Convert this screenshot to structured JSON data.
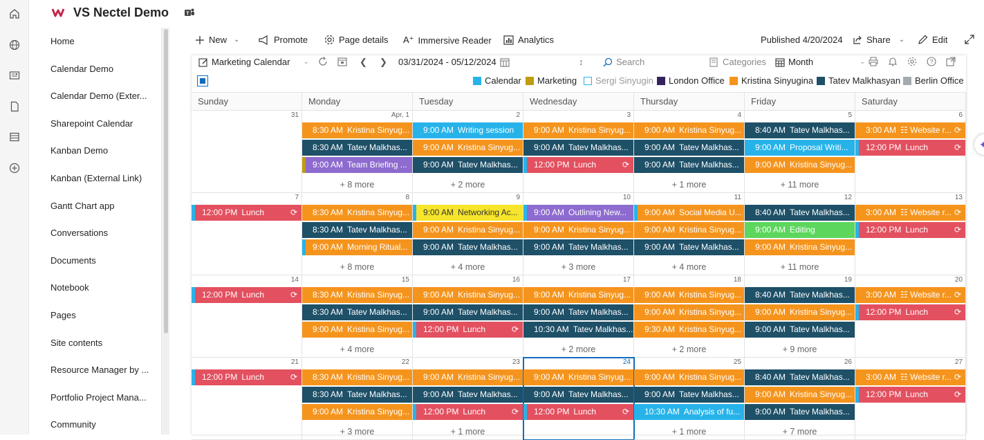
{
  "site": {
    "title": "VS Nectel Demo"
  },
  "rail": [
    "home-icon",
    "globe-icon",
    "news-icon",
    "file-icon",
    "list-icon",
    "add-icon"
  ],
  "nav": [
    "Home",
    "Calendar Demo",
    "Calendar Demo (Exter...",
    "Sharepoint Calendar",
    "Kanban Demo",
    "Kanban (External Link)",
    "Gantt Chart app",
    "Conversations",
    "Documents",
    "Notebook",
    "Pages",
    "Site contents",
    "Resource Manager by ...",
    "Portfolio Project Mana...",
    "Community"
  ],
  "command": {
    "new": "New",
    "promote": "Promote",
    "page_details": "Page details",
    "immersive": "Immersive Reader",
    "analytics": "Analytics",
    "published": "Published 4/20/2024",
    "share": "Share",
    "edit": "Edit"
  },
  "calendar": {
    "name": "Marketing Calendar",
    "range": "03/31/2024 - 05/12/2024",
    "search_placeholder": "Search",
    "categories": "Categories",
    "view": "Month",
    "legend": [
      {
        "label": "Calendar",
        "color": "#27b3ea",
        "outline": false
      },
      {
        "label": "Marketing",
        "color": "#c09b10",
        "outline": false
      },
      {
        "label": "Sergi Sinyugin",
        "color": "#ffffff",
        "outline": true
      },
      {
        "label": "London Office",
        "color": "#34225c",
        "outline": false
      },
      {
        "label": "Kristina Sinyugina",
        "color": "#f5941d",
        "outline": false
      },
      {
        "label": "Tatev Malkhasyan",
        "color": "#1e5068",
        "outline": false
      },
      {
        "label": "Berlin Office",
        "color": "#a5aaae",
        "outline": false
      }
    ],
    "days": [
      "Sunday",
      "Monday",
      "Tuesday",
      "Wednesday",
      "Thursday",
      "Friday",
      "Saturday"
    ],
    "weeks": [
      {
        "nums": [
          "31",
          "Apr, 1",
          "2",
          "3",
          "4",
          "5",
          "6"
        ],
        "events": [
          [],
          [
            {
              "t": "8:30 AM",
              "n": "Kristina Sinyug...",
              "c": "orange"
            },
            {
              "t": "8:30 AM",
              "n": "Tatev Malkhas...",
              "c": "teal"
            },
            {
              "t": "9:00 AM",
              "n": "Team Briefing ...",
              "c": "purple",
              "b": "#c09b10"
            }
          ],
          [
            {
              "t": "9:00 AM",
              "n": "Writing session",
              "c": "blue"
            },
            {
              "t": "9:00 AM",
              "n": "Kristina Sinyug...",
              "c": "orange"
            },
            {
              "t": "9:00 AM",
              "n": "Tatev Malkhas...",
              "c": "teal"
            }
          ],
          [
            {
              "t": "9:00 AM",
              "n": "Kristina Sinyug...",
              "c": "orange"
            },
            {
              "t": "9:00 AM",
              "n": "Tatev Malkhas...",
              "c": "teal"
            },
            {
              "t": "12:00 PM",
              "n": "Lunch",
              "c": "red",
              "b": "#27b3ea",
              "r": true
            }
          ],
          [
            {
              "t": "9:00 AM",
              "n": "Kristina Sinyug...",
              "c": "orange"
            },
            {
              "t": "9:00 AM",
              "n": "Tatev Malkhas...",
              "c": "teal"
            },
            {
              "t": "9:00 AM",
              "n": "Tatev Malkhas...",
              "c": "teal"
            }
          ],
          [
            {
              "t": "8:40 AM",
              "n": "Tatev Malkhas...",
              "c": "teal"
            },
            {
              "t": "9:00 AM",
              "n": "Proposal Writi...",
              "c": "blue"
            },
            {
              "t": "9:00 AM",
              "n": "Kristina Sinyug...",
              "c": "orange"
            }
          ],
          [
            {
              "t": "3:00 AM",
              "n": "Website r...",
              "c": "orange",
              "r": true,
              "teams": true
            },
            {
              "t": "12:00 PM",
              "n": "Lunch",
              "c": "red",
              "b": "#27b3ea",
              "r": true
            }
          ]
        ],
        "more": [
          "",
          "+ 8 more",
          "+ 2 more",
          "",
          "+ 1 more",
          "+ 11 more",
          ""
        ]
      },
      {
        "nums": [
          "7",
          "8",
          "9",
          "10",
          "11",
          "12",
          "13"
        ],
        "events": [
          [
            {
              "t": "12:00 PM",
              "n": "Lunch",
              "c": "red",
              "b": "#27b3ea",
              "r": true
            }
          ],
          [
            {
              "t": "8:30 AM",
              "n": "Kristina Sinyug...",
              "c": "orange"
            },
            {
              "t": "8:30 AM",
              "n": "Tatev Malkhas...",
              "c": "teal"
            },
            {
              "t": "9:00 AM",
              "n": "Morning Ritual...",
              "c": "orange",
              "b": "#27b3ea"
            }
          ],
          [
            {
              "t": "9:00 AM",
              "n": "Networking Ac...",
              "c": "yellow",
              "b": "#27b3ea"
            },
            {
              "t": "9:00 AM",
              "n": "Kristina Sinyug...",
              "c": "orange"
            },
            {
              "t": "9:00 AM",
              "n": "Tatev Malkhas...",
              "c": "teal"
            }
          ],
          [
            {
              "t": "9:00 AM",
              "n": "Outlining New...",
              "c": "purple",
              "b": "#27b3ea"
            },
            {
              "t": "9:00 AM",
              "n": "Kristina Sinyug...",
              "c": "orange"
            },
            {
              "t": "9:00 AM",
              "n": "Tatev Malkhas...",
              "c": "teal"
            }
          ],
          [
            {
              "t": "9:00 AM",
              "n": "Social Media U...",
              "c": "orange",
              "b": "#27b3ea"
            },
            {
              "t": "9:00 AM",
              "n": "Kristina Sinyug...",
              "c": "orange"
            },
            {
              "t": "9:00 AM",
              "n": "Tatev Malkhas...",
              "c": "teal"
            }
          ],
          [
            {
              "t": "8:40 AM",
              "n": "Tatev Malkhas...",
              "c": "teal"
            },
            {
              "t": "9:00 AM",
              "n": "Editing",
              "c": "green"
            },
            {
              "t": "9:00 AM",
              "n": "Kristina Sinyug...",
              "c": "orange"
            }
          ],
          [
            {
              "t": "3:00 AM",
              "n": "Website r...",
              "c": "orange",
              "r": true,
              "teams": true
            },
            {
              "t": "12:00 PM",
              "n": "Lunch",
              "c": "red",
              "b": "#27b3ea",
              "r": true
            }
          ]
        ],
        "more": [
          "",
          "+ 8 more",
          "+ 4 more",
          "+ 3 more",
          "+ 4 more",
          "+ 11 more",
          ""
        ]
      },
      {
        "nums": [
          "14",
          "15",
          "16",
          "17",
          "18",
          "19",
          "20"
        ],
        "events": [
          [
            {
              "t": "12:00 PM",
              "n": "Lunch",
              "c": "red",
              "b": "#27b3ea",
              "r": true
            }
          ],
          [
            {
              "t": "8:30 AM",
              "n": "Kristina Sinyug...",
              "c": "orange"
            },
            {
              "t": "8:30 AM",
              "n": "Tatev Malkhas...",
              "c": "teal"
            },
            {
              "t": "9:00 AM",
              "n": "Kristina Sinyug...",
              "c": "orange"
            }
          ],
          [
            {
              "t": "9:00 AM",
              "n": "Kristina Sinyug...",
              "c": "orange"
            },
            {
              "t": "9:00 AM",
              "n": "Tatev Malkhas...",
              "c": "teal"
            },
            {
              "t": "12:00 PM",
              "n": "Lunch",
              "c": "red",
              "b": "#27b3ea",
              "r": true
            }
          ],
          [
            {
              "t": "9:00 AM",
              "n": "Kristina Sinyug...",
              "c": "orange"
            },
            {
              "t": "9:00 AM",
              "n": "Tatev Malkhas...",
              "c": "teal"
            },
            {
              "t": "10:30 AM",
              "n": "Tatev Malkhas...",
              "c": "teal"
            }
          ],
          [
            {
              "t": "9:00 AM",
              "n": "Kristina Sinyug...",
              "c": "orange"
            },
            {
              "t": "9:00 AM",
              "n": "Kristina Sinyug...",
              "c": "orange"
            },
            {
              "t": "9:30 AM",
              "n": "Kristina Sinyug...",
              "c": "orange"
            }
          ],
          [
            {
              "t": "8:40 AM",
              "n": "Tatev Malkhas...",
              "c": "teal"
            },
            {
              "t": "9:00 AM",
              "n": "Kristina Sinyug...",
              "c": "orange"
            },
            {
              "t": "9:00 AM",
              "n": "Tatev Malkhas...",
              "c": "teal"
            }
          ],
          [
            {
              "t": "3:00 AM",
              "n": "Website r...",
              "c": "orange",
              "r": true,
              "teams": true
            },
            {
              "t": "12:00 PM",
              "n": "Lunch",
              "c": "red",
              "b": "#27b3ea",
              "r": true
            }
          ]
        ],
        "more": [
          "",
          "+ 4 more",
          "",
          "+ 2 more",
          "+ 2 more",
          "+ 9 more",
          ""
        ]
      },
      {
        "nums": [
          "21",
          "22",
          "23",
          "24",
          "25",
          "26",
          "27"
        ],
        "events": [
          [
            {
              "t": "12:00 PM",
              "n": "Lunch",
              "c": "red",
              "b": "#27b3ea",
              "r": true
            }
          ],
          [
            {
              "t": "8:30 AM",
              "n": "Kristina Sinyug...",
              "c": "orange"
            },
            {
              "t": "8:30 AM",
              "n": "Tatev Malkhas...",
              "c": "teal"
            },
            {
              "t": "9:00 AM",
              "n": "Kristina Sinyug...",
              "c": "orange"
            }
          ],
          [
            {
              "t": "9:00 AM",
              "n": "Kristina Sinyug...",
              "c": "orange"
            },
            {
              "t": "9:00 AM",
              "n": "Tatev Malkhas...",
              "c": "teal"
            },
            {
              "t": "12:00 PM",
              "n": "Lunch",
              "c": "red",
              "b": "#27b3ea",
              "r": true
            }
          ],
          [
            {
              "t": "9:00 AM",
              "n": "Kristina Sinyug...",
              "c": "orange"
            },
            {
              "t": "9:00 AM",
              "n": "Tatev Malkhas...",
              "c": "teal"
            },
            {
              "t": "12:00 PM",
              "n": "Lunch",
              "c": "red",
              "b": "#27b3ea",
              "r": true
            }
          ],
          [
            {
              "t": "9:00 AM",
              "n": "Kristina Sinyug...",
              "c": "orange"
            },
            {
              "t": "9:00 AM",
              "n": "Tatev Malkhas...",
              "c": "teal"
            },
            {
              "t": "10:30 AM",
              "n": "Analysis of fu...",
              "c": "blue"
            }
          ],
          [
            {
              "t": "8:40 AM",
              "n": "Tatev Malkhas...",
              "c": "teal"
            },
            {
              "t": "9:00 AM",
              "n": "Kristina Sinyug...",
              "c": "orange"
            },
            {
              "t": "9:00 AM",
              "n": "Tatev Malkhas...",
              "c": "teal"
            }
          ],
          [
            {
              "t": "3:00 AM",
              "n": "Website r...",
              "c": "orange",
              "r": true,
              "teams": true
            },
            {
              "t": "12:00 PM",
              "n": "Lunch",
              "c": "red",
              "b": "#27b3ea",
              "r": true
            }
          ]
        ],
        "more": [
          "",
          "+ 3 more",
          "+ 1 more",
          "",
          "+ 1 more",
          "+ 7 more",
          ""
        ],
        "today_index": 3
      }
    ],
    "colors": {
      "orange": "#f5941d",
      "teal": "#1e5068",
      "blue": "#27b3ea",
      "purple": "#8d6bcf",
      "red": "#e3505f",
      "yellow": "#f6e52b",
      "green": "#5cd65c",
      "today": "#0f6cbd"
    }
  }
}
